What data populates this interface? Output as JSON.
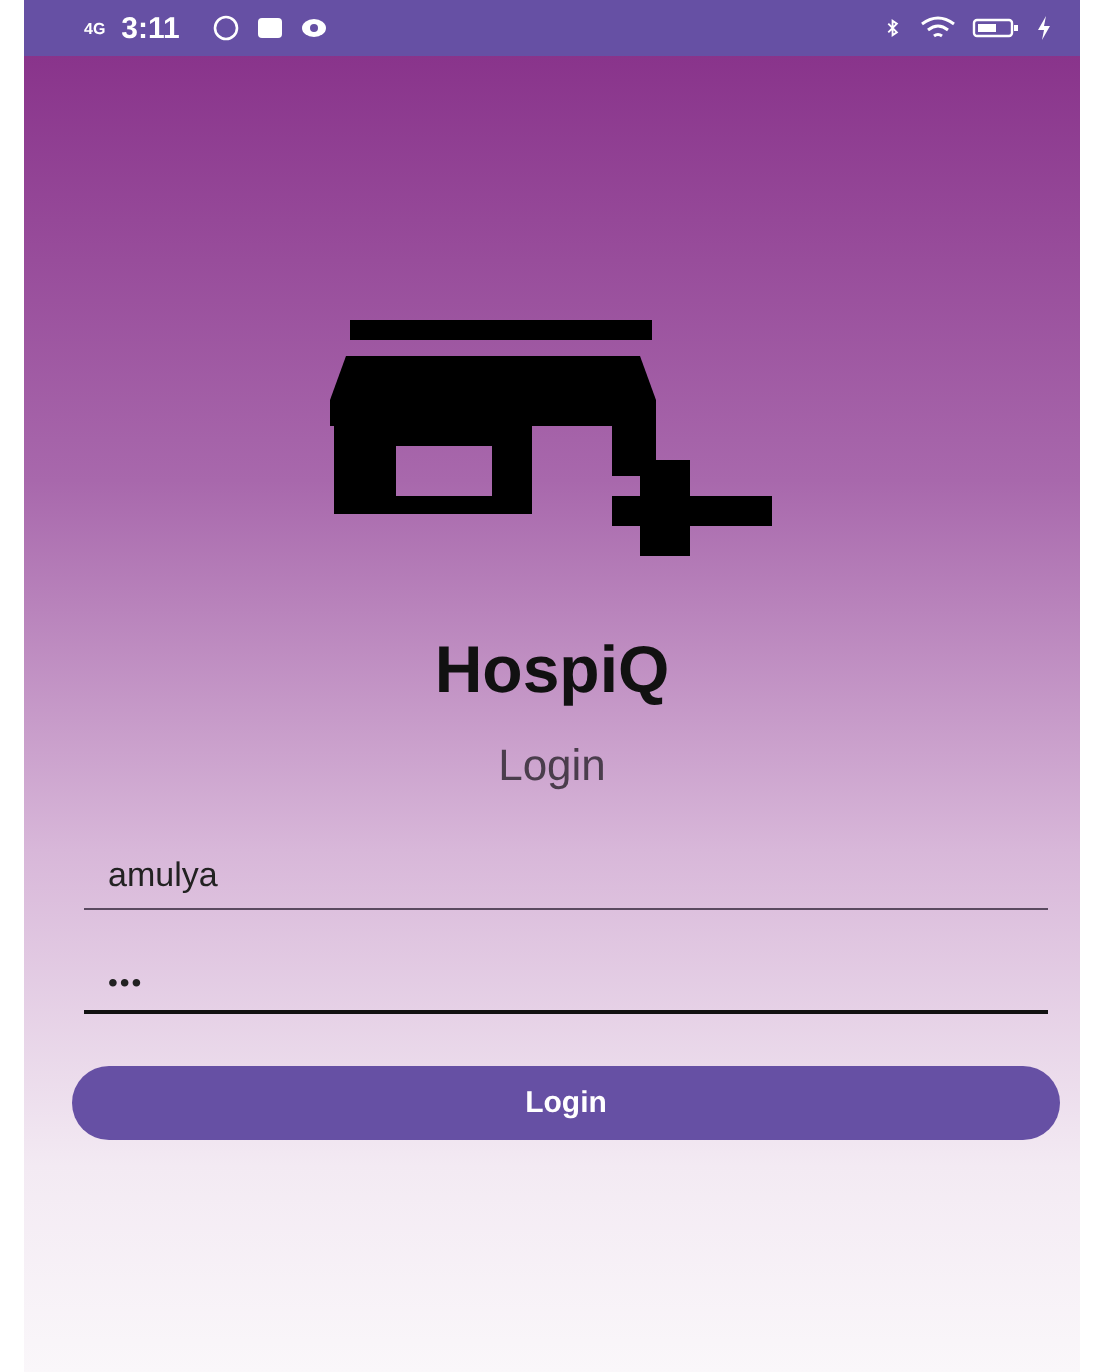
{
  "status_bar": {
    "network": "4G",
    "time": "3:11"
  },
  "app": {
    "name": "HospiQ",
    "subtitle": "Login"
  },
  "fields": [
    {
      "kind": "text",
      "value": "amulya",
      "focused": false
    },
    {
      "kind": "password",
      "value": "•••",
      "focused": true
    }
  ],
  "button": {
    "label": "Login"
  }
}
